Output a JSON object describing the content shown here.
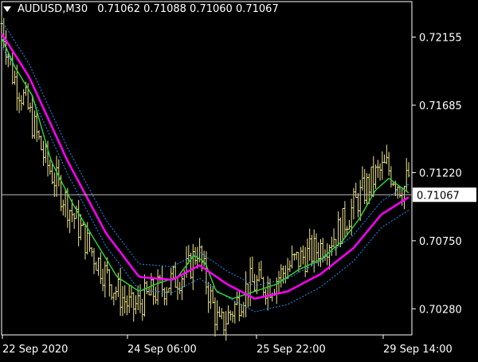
{
  "header": {
    "symbol": "AUDUSD,M30",
    "ohlc": [
      "0.71062",
      "0.71088",
      "0.71060",
      "0.71067"
    ]
  },
  "colors": {
    "background": "#000000",
    "price_bars": "#f0e68c",
    "ma_fast": "#32cd32",
    "ma_slow": "#ff00ff",
    "bands": "#1e90ff",
    "current_line": "#c0c0c0"
  },
  "current_price_label": "0.71067",
  "chart_data": {
    "type": "line",
    "title": "AUDUSD,M30",
    "yaxis_ticks": [
      0.72155,
      0.71685,
      0.7122,
      0.7075,
      0.7028
    ],
    "xaxis_labels": [
      "22 Sep 2020",
      "24 Sep 06:00",
      "25 Sep 22:00",
      "29 Sep 14:00"
    ],
    "ylim": [
      0.701,
      0.724
    ],
    "grid": false,
    "current_price": 0.71067,
    "bars_key_points": [
      [
        0,
        0.7225
      ],
      [
        10,
        0.719
      ],
      [
        22,
        0.717
      ],
      [
        40,
        0.713
      ],
      [
        60,
        0.71
      ],
      [
        80,
        0.707
      ],
      [
        100,
        0.7045
      ],
      [
        118,
        0.7028
      ],
      [
        130,
        0.7035
      ],
      [
        150,
        0.7045
      ],
      [
        170,
        0.7055
      ],
      [
        178,
        0.707
      ],
      [
        190,
        0.7035
      ],
      [
        198,
        0.7015
      ],
      [
        208,
        0.7025
      ],
      [
        225,
        0.7045
      ],
      [
        245,
        0.7045
      ],
      [
        265,
        0.706
      ],
      [
        285,
        0.7068
      ],
      [
        305,
        0.708
      ],
      [
        325,
        0.7105
      ],
      [
        340,
        0.712
      ],
      [
        350,
        0.7126
      ],
      [
        365,
        0.711
      ],
      [
        370,
        0.712
      ]
    ],
    "series": [
      {
        "key": "fast",
        "values": [
          [
            0,
            0.7215
          ],
          [
            12,
            0.7195
          ],
          [
            28,
            0.7175
          ],
          [
            45,
            0.713
          ],
          [
            65,
            0.71
          ],
          [
            85,
            0.7075
          ],
          [
            105,
            0.705
          ],
          [
            125,
            0.704
          ],
          [
            140,
            0.7045
          ],
          [
            160,
            0.705
          ],
          [
            175,
            0.7065
          ],
          [
            185,
            0.706
          ],
          [
            195,
            0.704
          ],
          [
            210,
            0.7035
          ],
          [
            230,
            0.704
          ],
          [
            250,
            0.7045
          ],
          [
            270,
            0.7055
          ],
          [
            290,
            0.7062
          ],
          [
            310,
            0.7075
          ],
          [
            325,
            0.709
          ],
          [
            340,
            0.711
          ],
          [
            352,
            0.7118
          ],
          [
            370,
            0.7108
          ]
        ]
      },
      {
        "key": "slow",
        "values": [
          [
            0,
            0.7218
          ],
          [
            25,
            0.7188
          ],
          [
            60,
            0.713
          ],
          [
            95,
            0.708
          ],
          [
            125,
            0.705
          ],
          [
            155,
            0.7048
          ],
          [
            180,
            0.7058
          ],
          [
            205,
            0.7045
          ],
          [
            230,
            0.7035
          ],
          [
            260,
            0.704
          ],
          [
            290,
            0.7052
          ],
          [
            320,
            0.707
          ],
          [
            345,
            0.7093
          ],
          [
            370,
            0.7105
          ]
        ]
      }
    ]
  }
}
